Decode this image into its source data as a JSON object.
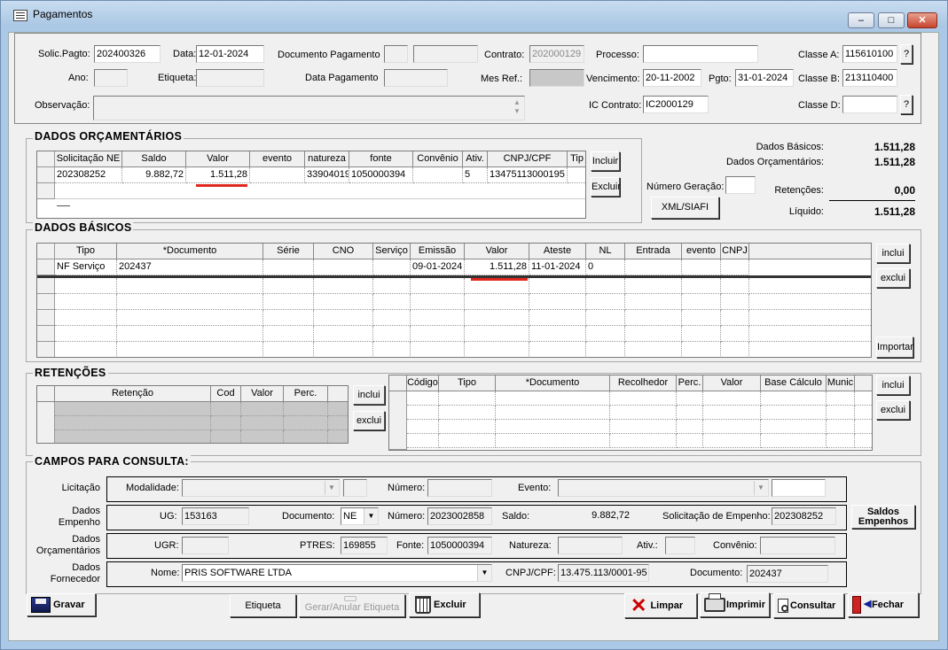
{
  "window": {
    "title": "Pagamentos",
    "min": "–",
    "max": "□",
    "close": "✕"
  },
  "header": {
    "solic_label": "Solic.Pagto:",
    "solic_value": "202400326",
    "data_label": "Data:",
    "data_value": "12-01-2024",
    "docpag_label": "Documento Pagamento",
    "contrato_label": "Contrato:",
    "contrato_value": "202000129",
    "processo_label": "Processo:",
    "processo_value": "",
    "classe_a_label": "Classe A:",
    "classe_a_value": "115610100",
    "ano_label": "Ano:",
    "etiqueta_label": "Etiqueta:",
    "datapag_label": "Data Pagamento",
    "mesref_label": "Mes Ref.:",
    "venc_label": "Vencimento:",
    "venc_value": "20-11-2002",
    "pgto_label": "Pgto:",
    "pgto_value": "31-01-2024",
    "classe_b_label": "Classe B:",
    "classe_b_value": "213110400",
    "obs_label": "Observação:",
    "ic_label": "IC Contrato:",
    "ic_value": "IC2000129",
    "classe_d_label": "Classe D:",
    "classe_d_value": "",
    "help": "?"
  },
  "orc": {
    "title": "DADOS ORÇAMENTÁRIOS",
    "columns": [
      "Solicitação NE",
      "Saldo",
      "Valor",
      "evento",
      "natureza",
      "fonte",
      "Convênio",
      "Ativ.",
      "CNPJ/CPF",
      "Tip"
    ],
    "row": [
      "202308252",
      "9.882,72",
      "1.511,28",
      "",
      "33904019",
      "1050000394",
      "",
      "5",
      "13475113000195",
      ""
    ],
    "incluir": "Incluir",
    "excluir": "Excluir"
  },
  "summary": {
    "basicos_label": "Dados Básicos:",
    "basicos_value": "1.511,28",
    "orc_label": "Dados Orçamentários:",
    "orc_value": "1.511,28",
    "numger_label": "Número Geração:",
    "ret_label": "Retenções:",
    "ret_value": "0,00",
    "liq_label": "Líquido:",
    "liq_value": "1.511,28",
    "xml_button": "XML/SIAFI"
  },
  "basicos": {
    "title": "DADOS BÁSICOS",
    "columns": [
      "Tipo",
      "*Documento",
      "Série",
      "CNO",
      "Serviço",
      "Emissão",
      "Valor",
      "Ateste",
      "NL",
      "Entrada",
      "evento",
      "CNPJ"
    ],
    "row": [
      "NF Serviço",
      "202437",
      "",
      "",
      "",
      "09-01-2024",
      "1.511,28",
      "11-01-2024",
      "0",
      "",
      "",
      ""
    ],
    "inclui": "inclui",
    "exclui": "exclui",
    "importar": "Importar"
  },
  "retencoes": {
    "title": "RETENÇÕES",
    "left_columns": [
      "Retenção",
      "Cod",
      "Valor",
      "Perc."
    ],
    "right_columns": [
      "Código",
      "Tipo",
      "*Documento",
      "Recolhedor",
      "Perc.",
      "Valor",
      "Base Cálculo",
      "Munic"
    ],
    "inclui": "inclui",
    "exclui": "exclui"
  },
  "consulta": {
    "title": "CAMPOS PARA CONSULTA:",
    "licitacao_label": "Licitação",
    "modalidade_label": "Modalidade:",
    "numero_label": "Número:",
    "evento_label": "Evento:",
    "empenho_label": "Dados\nEmpenho",
    "ug_label": "UG:",
    "ug_value": "153163",
    "documento_label": "Documento:",
    "documento_value": "NE",
    "emp_numero_value": "2023002858",
    "saldo_label": "Saldo:",
    "saldo_value": "9.882,72",
    "solemp_label": "Solicitação de Empenho:",
    "solemp_value": "202308252",
    "orc_label": "Dados\nOrçamentários",
    "ugr_label": "UGR:",
    "ptres_label": "PTRES:",
    "ptres_value": "169855",
    "fonte_label": "Fonte:",
    "fonte_value": "1050000394",
    "natureza_label": "Natureza:",
    "ativ_label": "Ativ.:",
    "convenio_label": "Convênio:",
    "forn_label": "Dados\nFornecedor",
    "nome_label": "Nome:",
    "nome_value": "PRIS SOFTWARE LTDA",
    "cnpj_label": "CNPJ/CPF:",
    "cnpj_value": "13.475.113/0001-95",
    "doc_label": "Documento:",
    "doc_value": "202437",
    "saldos_button": "Saldos\nEmpenhos"
  },
  "footer": {
    "gravar": "Gravar",
    "etiqueta": "Etiqueta",
    "gerar": "Gerar/Anular Etiqueta",
    "excluir": "Excluir",
    "limpar": "Limpar",
    "imprimir": "Imprimir",
    "consultar": "Consultar",
    "fechar": "Fechar"
  }
}
